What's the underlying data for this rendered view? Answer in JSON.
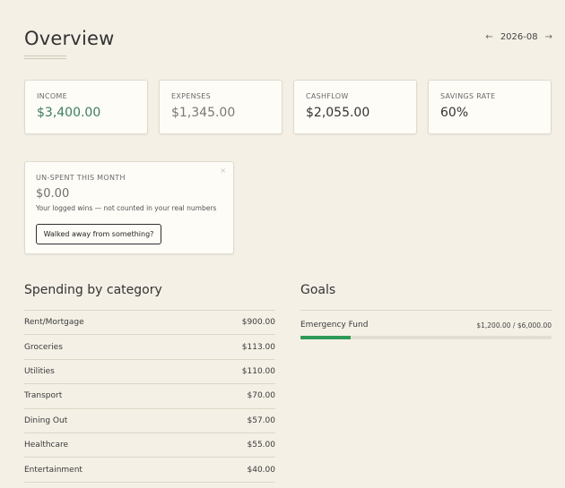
{
  "header": {
    "title": "Overview",
    "month": "2026-08",
    "prev_icon": "arrow-left-icon",
    "next_icon": "arrow-right-icon"
  },
  "stats": [
    {
      "label": "INCOME",
      "value": "$3,400.00",
      "color": "#3e7d5c"
    },
    {
      "label": "EXPENSES",
      "value": "$1,345.00",
      "color": "#7d7a6e"
    },
    {
      "label": "CASHFLOW",
      "value": "$2,055.00",
      "color": "#333333"
    },
    {
      "label": "SAVINGS RATE",
      "value": "60%",
      "color": "#333333"
    }
  ],
  "unspent": {
    "label": "UN-SPENT THIS MONTH",
    "value": "$0.00",
    "note": "Your logged wins — not counted in your real numbers",
    "button_label": "Walked away from something?"
  },
  "spending": {
    "title": "Spending by category",
    "rows": [
      {
        "category": "Rent/Mortgage",
        "amount": "$900.00"
      },
      {
        "category": "Groceries",
        "amount": "$113.00"
      },
      {
        "category": "Utilities",
        "amount": "$110.00"
      },
      {
        "category": "Transport",
        "amount": "$70.00"
      },
      {
        "category": "Dining Out",
        "amount": "$57.00"
      },
      {
        "category": "Healthcare",
        "amount": "$55.00"
      },
      {
        "category": "Entertainment",
        "amount": "$40.00"
      }
    ]
  },
  "goals": {
    "title": "Goals",
    "items": [
      {
        "name": "Emergency Fund",
        "amount": "$1,200.00 / $6,000.00",
        "progress": 0.2,
        "color": "#2f9a57"
      }
    ]
  }
}
